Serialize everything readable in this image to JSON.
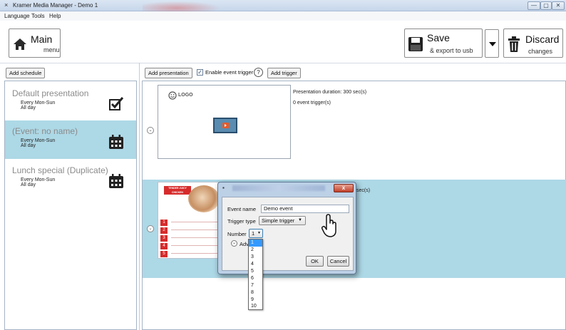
{
  "window": {
    "title": "Kramer Media Manager - Demo 1",
    "min": "—",
    "max": "▢",
    "close": "✕"
  },
  "menu": [
    "Language",
    "Tools",
    "Help"
  ],
  "toolbar": {
    "main": {
      "label": "Main",
      "sub": "menu"
    },
    "save": {
      "label": "Save",
      "sub": "& export to usb"
    },
    "discard": {
      "label": "Discard",
      "sub": "changes"
    }
  },
  "actions": {
    "add_schedule": "Add schedule",
    "add_presentation": "Add presentation",
    "enable_event_trigger": "Enable event trigger",
    "help": "?",
    "add_trigger": "Add trigger"
  },
  "schedules": [
    {
      "name": "Default presentation",
      "days": "Every Mon-Sun",
      "hours": "All day",
      "icon": "checkbox-icon",
      "selected": false
    },
    {
      "name": "(Event: no name)",
      "days": "Every Mon-Sun",
      "hours": "All day",
      "icon": "calendar-icon",
      "selected": true
    },
    {
      "name": "Lunch special (Duplicate)",
      "days": "Every Mon-Sun",
      "hours": "All day",
      "icon": "calendar-icon",
      "selected": false
    }
  ],
  "presentations": [
    {
      "logo": "LOGO",
      "duration": "Presentation duration: 300 sec(s)",
      "triggers": "0 event trigger(s)"
    },
    {
      "partial_text": "sec(s)",
      "menu_header": "TENDER JUICY CHICKEN",
      "menu_numbers": [
        "1",
        "2",
        "3",
        "4",
        "5"
      ]
    }
  ],
  "dialog": {
    "event_name_label": "Event name",
    "event_name_value": "Demo event",
    "trigger_type_label": "Trigger type",
    "trigger_type_value": "Simple trigger",
    "number_label": "Number",
    "number_value": "1",
    "advanced_label": "Adva",
    "ok": "OK",
    "cancel": "Cancel",
    "close": "x"
  },
  "number_options": [
    "1",
    "2",
    "3",
    "4",
    "5",
    "6",
    "7",
    "8",
    "9",
    "10"
  ],
  "colors": {
    "selection": "#add8e6",
    "list_highlight": "#3399ff"
  }
}
